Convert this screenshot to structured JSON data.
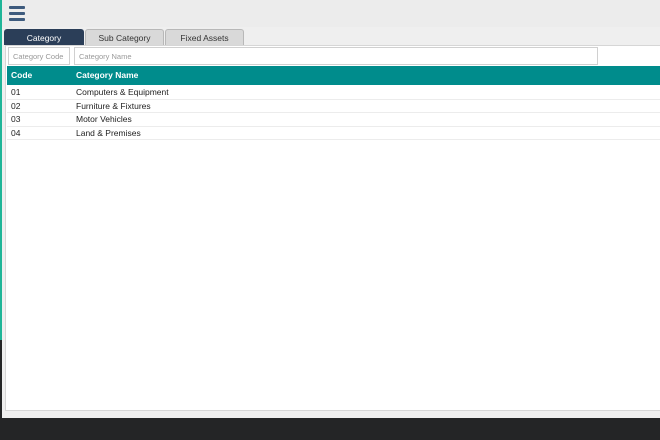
{
  "tabs": [
    {
      "label": "Category",
      "active": true
    },
    {
      "label": "Sub Category",
      "active": false
    },
    {
      "label": "Fixed Assets",
      "active": false
    }
  ],
  "filters": {
    "code_placeholder": "Category Code",
    "name_placeholder": "Category Name"
  },
  "table": {
    "columns": [
      "Code",
      "Category Name"
    ],
    "rows": [
      {
        "code": "01",
        "name": "Computers & Equipment"
      },
      {
        "code": "02",
        "name": "Furniture & Fixtures"
      },
      {
        "code": "03",
        "name": "Motor Vehicles"
      },
      {
        "code": "04",
        "name": "Land & Premises"
      }
    ]
  },
  "colors": {
    "header_teal": "#008c8c",
    "active_tab": "#2b3e58",
    "menu_icon": "#3d5a7d",
    "accent_green": "#1fb598"
  }
}
